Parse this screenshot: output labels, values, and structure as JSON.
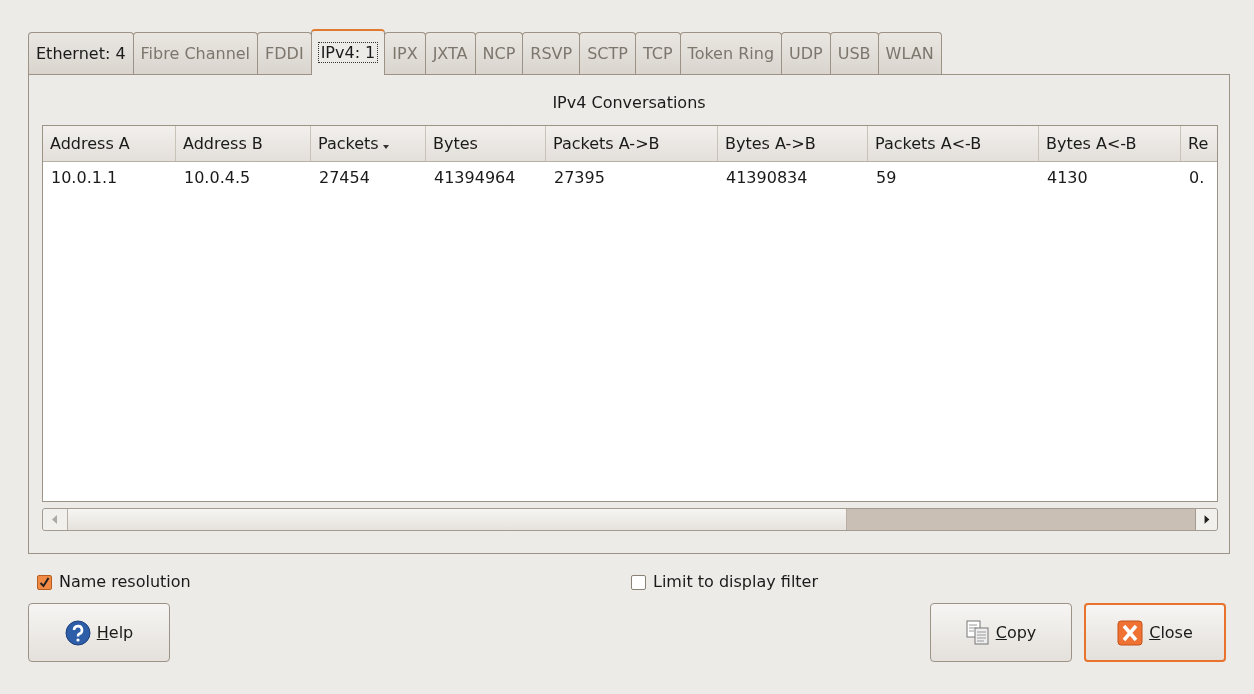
{
  "tabs": [
    {
      "label": "Ethernet: 4",
      "selected": false,
      "disabled": false
    },
    {
      "label": "Fibre Channel",
      "selected": false,
      "disabled": true
    },
    {
      "label": "FDDI",
      "selected": false,
      "disabled": true
    },
    {
      "label": "IPv4: 1",
      "selected": true,
      "disabled": false
    },
    {
      "label": "IPX",
      "selected": false,
      "disabled": true
    },
    {
      "label": "JXTA",
      "selected": false,
      "disabled": true
    },
    {
      "label": "NCP",
      "selected": false,
      "disabled": true
    },
    {
      "label": "RSVP",
      "selected": false,
      "disabled": true
    },
    {
      "label": "SCTP",
      "selected": false,
      "disabled": true
    },
    {
      "label": "TCP",
      "selected": false,
      "disabled": true
    },
    {
      "label": "Token Ring",
      "selected": false,
      "disabled": true
    },
    {
      "label": "UDP",
      "selected": false,
      "disabled": true
    },
    {
      "label": "USB",
      "selected": false,
      "disabled": true
    },
    {
      "label": "WLAN",
      "selected": false,
      "disabled": true
    }
  ],
  "panel_title": "IPv4 Conversations",
  "table": {
    "columns": [
      {
        "label": "Address A",
        "sorted": false
      },
      {
        "label": "Address B",
        "sorted": false
      },
      {
        "label": "Packets",
        "sorted": true
      },
      {
        "label": "Bytes",
        "sorted": false
      },
      {
        "label": "Packets A->B",
        "sorted": false
      },
      {
        "label": "Bytes A->B",
        "sorted": false
      },
      {
        "label": "Packets A<-B",
        "sorted": false
      },
      {
        "label": "Bytes A<-B",
        "sorted": false
      },
      {
        "label": "Re",
        "sorted": false
      }
    ],
    "rows": [
      [
        "10.0.1.1",
        "10.0.4.5",
        "27454",
        "41394964",
        "27395",
        "41390834",
        "59",
        "4130",
        "0."
      ]
    ]
  },
  "options": [
    {
      "label": "Name resolution",
      "checked": true
    },
    {
      "label": "Limit to display filter",
      "checked": false
    }
  ],
  "buttons": [
    {
      "kind": "help",
      "label": "Help",
      "underline_first": true,
      "default": false
    },
    {
      "kind": "copy",
      "label": "Copy",
      "underline_first": true,
      "default": false
    },
    {
      "kind": "close",
      "label": "Close",
      "underline_first": true,
      "default": true
    }
  ]
}
